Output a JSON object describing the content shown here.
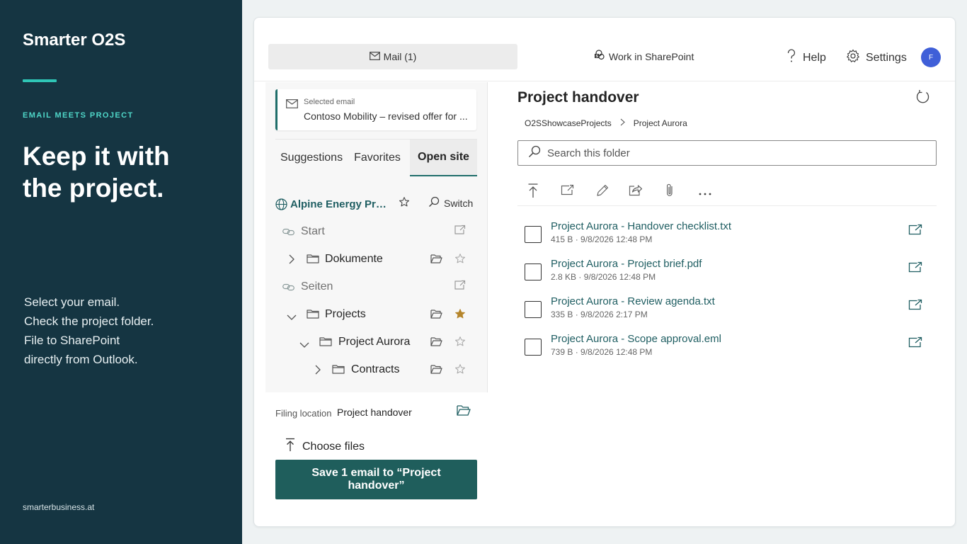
{
  "promo": {
    "brand": "Smarter O2S",
    "eyebrow": "EMAIL MEETS PROJECT",
    "headline": "Keep it with the project.",
    "body_lines": [
      "Select your email.",
      "Check the project folder.",
      "File to SharePoint",
      "directly from Outlook."
    ],
    "footer": "smarterbusiness.at",
    "accent_color": "#2fc6b6"
  },
  "header": {
    "mail_tab": "Mail (1)",
    "sharepoint_tab": "Work in SharePoint",
    "help": "Help",
    "settings": "Settings",
    "avatar_initial": "F"
  },
  "selected_email": {
    "label": "Selected email",
    "value": "Contoso Mobility – revised offer for ..."
  },
  "tabs": [
    {
      "label": "Suggestions",
      "active": false
    },
    {
      "label": "Favorites",
      "active": false
    },
    {
      "label": "Open site",
      "active": true
    }
  ],
  "site": {
    "name": "Alpine Energy Proj...",
    "switch_label": "Switch"
  },
  "tree": [
    {
      "label": "Start",
      "type": "link"
    },
    {
      "label": "Dokumente",
      "type": "folder",
      "expanded": false
    },
    {
      "label": "Seiten",
      "type": "link"
    },
    {
      "label": "Projects",
      "type": "folder",
      "expanded": true,
      "favorite": true
    },
    {
      "label": "Project Aurora",
      "type": "folder",
      "expanded": true,
      "favorite": false
    },
    {
      "label": "Contracts",
      "type": "folder",
      "expanded": false,
      "favorite": false
    }
  ],
  "filing": {
    "label": "Filing location",
    "value": "Project handover",
    "choose_files": "Choose files",
    "save_button": "Save 1 email to “Project handover”"
  },
  "folder": {
    "title": "Project handover",
    "breadcrumb": [
      "O2SShowcaseProjects",
      "Project Aurora"
    ],
    "search_placeholder": "Search this folder",
    "files": [
      {
        "name": "Project Aurora - Handover checklist.txt",
        "meta": "415 B · 9/8/2026 12:48 PM"
      },
      {
        "name": "Project Aurora - Project brief.pdf",
        "meta": "2.8 KB · 9/8/2026 12:48 PM"
      },
      {
        "name": "Project Aurora - Review agenda.txt",
        "meta": "335 B · 9/8/2026 2:17 PM"
      },
      {
        "name": "Project Aurora - Scope approval.eml",
        "meta": "739 B · 9/8/2026 12:48 PM"
      }
    ]
  },
  "colors": {
    "sidebar_bg": "#153542",
    "primary": "#1f5e5c",
    "link": "#1f5e62",
    "favorite_star": "#b5852b",
    "avatar": "#3f5fd8"
  }
}
